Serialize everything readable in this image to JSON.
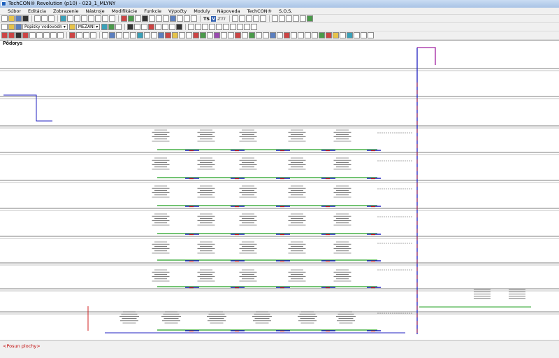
{
  "window": {
    "title": "TechCON® Revolution  (p10) - 023_1_MLYNY"
  },
  "menu": [
    "Súbor",
    "Editácia",
    "Zobrazenie",
    "Nástroje",
    "Modifikácie",
    "Funkcie",
    "Výpočty",
    "Moduly",
    "Nápoveda",
    "TechCON®",
    "S.O.S."
  ],
  "toolbar": {
    "dropdown_labels": "Popisky vodovodn",
    "dropdown_layer": "MEZANÍ",
    "ts_label": "TS",
    "v_label": "V",
    "zti_label": "ZTI"
  },
  "canvas": {
    "title": "Pôdorys"
  },
  "status": {
    "text": "<Posun plochy>"
  },
  "colors": {
    "pipe_blue": "#2020c0",
    "pipe_red": "#d02020",
    "pipe_green": "#20a020",
    "riser_magenta": "#a020a0"
  }
}
